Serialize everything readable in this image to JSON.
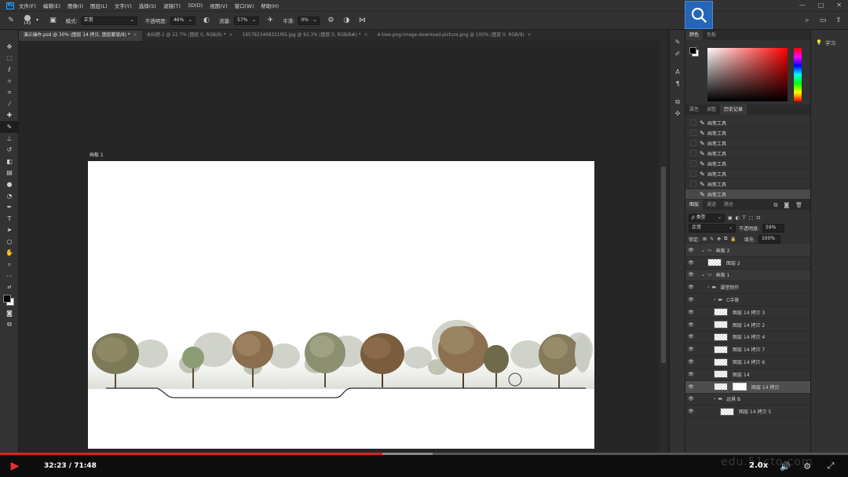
{
  "menu": {
    "items": [
      "文件(F)",
      "编辑(E)",
      "图像(I)",
      "图层(L)",
      "文字(Y)",
      "选择(S)",
      "滤镜(T)",
      "3D(D)",
      "视图(V)",
      "窗口(W)",
      "帮助(H)"
    ],
    "logo": "Ps",
    "window_buttons": [
      "—",
      "□",
      "✕"
    ]
  },
  "options": {
    "brush_size": "143",
    "mode_label": "模式:",
    "mode_value": "正常",
    "opacity_label": "不透明度:",
    "opacity_value": "46%",
    "flow_label": "流量:",
    "flow_value": "57%",
    "smooth_label": "平滑:",
    "smooth_value": "0%"
  },
  "tabs": [
    {
      "label": "演示操作.psd @ 30% (图层 14 拷贝, 图层蒙版/8) *",
      "active": true
    },
    {
      "label": "未标题-1 @ 22.7% (图层 0, RGB/8) *",
      "active": false
    },
    {
      "label": "1957823468321f65.jpg @ 93.3% (图层 0, RGB/8#) *",
      "active": false
    },
    {
      "label": "4-tree-png-image-download-picture.png @ 100% (图层 0, RGB/8)",
      "active": false
    }
  ],
  "artboard": {
    "label": "画板 1"
  },
  "color_panel": {
    "tabs": [
      "颜色",
      "色板"
    ]
  },
  "history_panel": {
    "tabs": [
      "属性",
      "调整",
      "历史记录"
    ],
    "items": [
      "画笔工具",
      "画笔工具",
      "画笔工具",
      "画笔工具",
      "画笔工具",
      "画笔工具",
      "画笔工具",
      "画笔工具"
    ]
  },
  "layers_panel": {
    "tabs": [
      "图层",
      "通道",
      "路径"
    ],
    "filter_label": "ρ 类型",
    "blend_mode": "正常",
    "opacity_label": "不透明度:",
    "opacity_value": "59%",
    "lock_label": "锁定:",
    "fill_label": "填充:",
    "fill_value": "100%",
    "layers": [
      {
        "name": "画板 2",
        "kind": "group",
        "indent": 0
      },
      {
        "name": "图层 2",
        "kind": "layer",
        "indent": 1
      },
      {
        "name": "画板 1",
        "kind": "group",
        "indent": 0
      },
      {
        "name": "课堂制作",
        "kind": "folder",
        "indent": 1
      },
      {
        "name": "C中景",
        "kind": "folder",
        "indent": 2
      },
      {
        "name": "图层 14 拷贝 3",
        "kind": "layer",
        "indent": 2
      },
      {
        "name": "图层 14 拷贝 2",
        "kind": "layer",
        "indent": 2
      },
      {
        "name": "图层 14 拷贝 4",
        "kind": "layer",
        "indent": 2
      },
      {
        "name": "图层 14 拷贝 7",
        "kind": "layer",
        "indent": 2
      },
      {
        "name": "图层 14 拷贝 6",
        "kind": "layer",
        "indent": 2
      },
      {
        "name": "图层 14",
        "kind": "layer",
        "indent": 2
      },
      {
        "name": "图层 14 拷贝",
        "kind": "selected",
        "indent": 2
      },
      {
        "name": "远景 B",
        "kind": "folder",
        "indent": 2
      },
      {
        "name": "图层 14 拷贝 5",
        "kind": "layer",
        "indent": 3
      }
    ]
  },
  "learn_panel": {
    "label": "学习"
  },
  "video": {
    "time": "32:23 / 71:48",
    "speed": "2.0x",
    "progress": 0.451,
    "buffered": 0.51,
    "watermark": "edu.51cto.com"
  }
}
